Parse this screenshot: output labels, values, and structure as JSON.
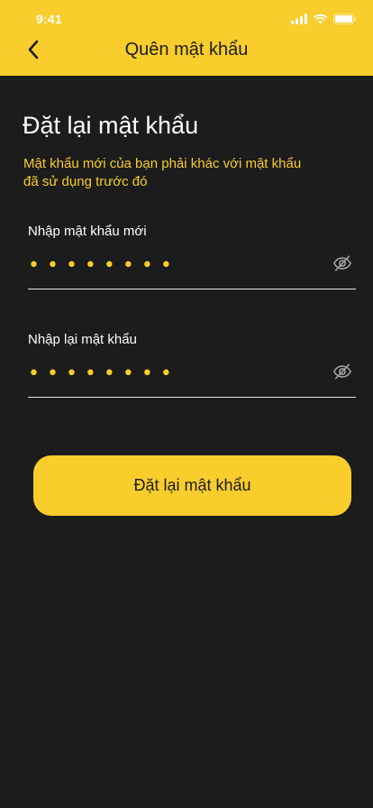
{
  "status": {
    "time": "9:41",
    "signal_icon": "signal-icon",
    "wifi_icon": "wifi-icon",
    "battery_icon": "battery-icon"
  },
  "header": {
    "back_icon": "chevron-left-icon",
    "title": "Quên mật khẩu"
  },
  "main": {
    "title": "Đặt lại mật khẩu",
    "subtitle": "Mật khẩu mới của bạn phải khác với mật khẩu đã sử dụng trước đó"
  },
  "fields": {
    "new_password": {
      "label": "Nhập mật khẩu mới",
      "value": "••••••••",
      "icon": "eye-off-icon"
    },
    "confirm_password": {
      "label": "Nhập lại mật khẩu",
      "value": "••••••••",
      "icon": "eye-off-icon"
    }
  },
  "button": {
    "label": "Đặt lại mật khẩu"
  },
  "colors": {
    "accent": "#F8CD2C",
    "background": "#1C1C1C"
  }
}
